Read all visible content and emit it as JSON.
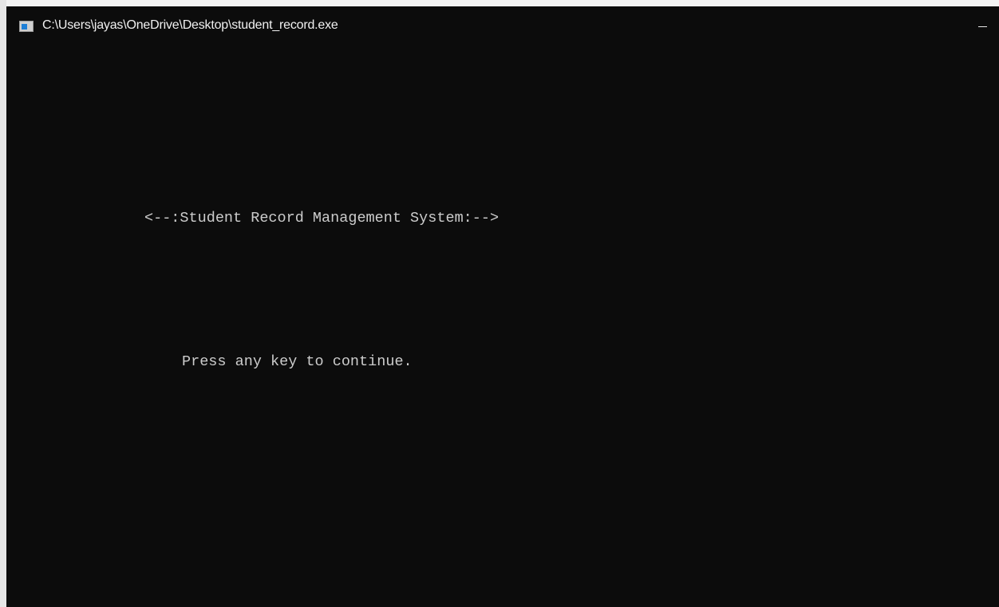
{
  "window": {
    "title": "C:\\Users\\jayas\\OneDrive\\Desktop\\student_record.exe",
    "icon": "console-app-icon",
    "controls": [
      "minimize-icon"
    ]
  },
  "console": {
    "heading": "<--:Student Record Management System:-->",
    "prompt": "Press any key to continue."
  },
  "colors": {
    "background": "#0c0c0c",
    "text": "#cccccc",
    "title_text": "#f0f0f0"
  }
}
